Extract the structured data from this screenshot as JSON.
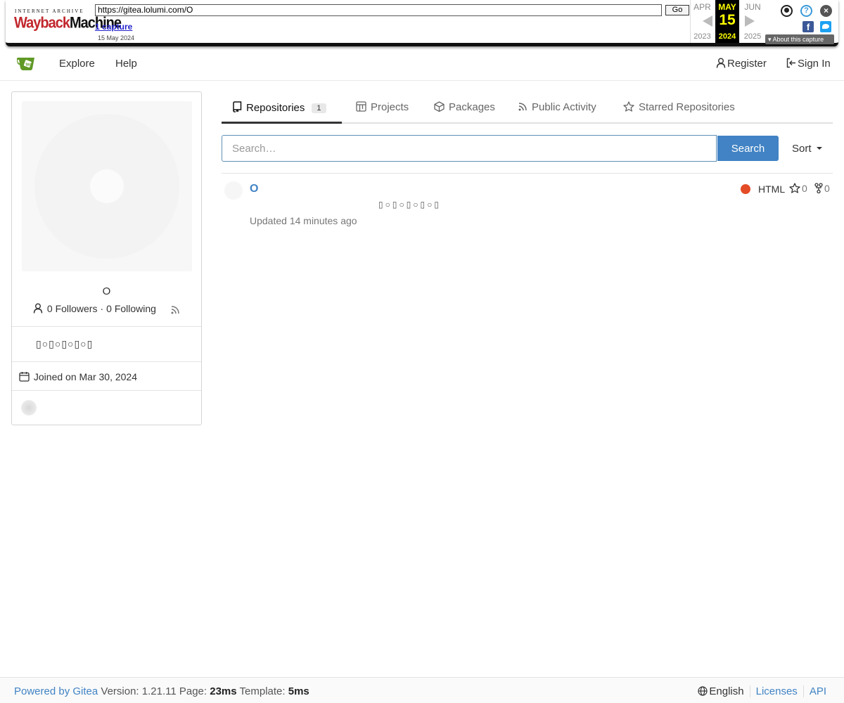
{
  "wayback": {
    "logo_top": "INTERNET ARCHIVE",
    "logo_main_a": "Wayback",
    "logo_main_b": "Machine",
    "url": "https://gitea.lolumi.com/O",
    "go_label": "Go",
    "captures": "1 capture",
    "capture_date": "15 May 2024",
    "prev_month": "APR",
    "prev_year": "2023",
    "cur_month": "MAY",
    "cur_day": "15",
    "cur_year": "2024",
    "next_month": "JUN",
    "next_year": "2025",
    "help_glyph": "?",
    "close_glyph": "×",
    "facebook_glyph": "f",
    "about": "About this capture"
  },
  "nav": {
    "explore": "Explore",
    "help": "Help",
    "register": "Register",
    "signin": "Sign In"
  },
  "profile": {
    "name": "O",
    "followers": "0 Followers",
    "separator": "·",
    "following": "0 Following",
    "bio": "▯○▯○▯○▯○▯",
    "joined": "Joined on Mar 30, 2024"
  },
  "tabs": {
    "repositories": "Repositories",
    "repo_count": "1",
    "projects": "Projects",
    "packages": "Packages",
    "activity": "Public Activity",
    "starred": "Starred Repositories"
  },
  "search": {
    "placeholder": "Search…",
    "button": "Search",
    "sort": "Sort"
  },
  "repos": [
    {
      "name": "O",
      "description": "▯○▯○▯○▯○▯",
      "updated": "Updated 14 minutes ago",
      "language": "HTML",
      "language_color": "#e34c26",
      "stars": "0",
      "forks": "0"
    }
  ],
  "footer": {
    "powered": "Powered by Gitea",
    "version": " Version: 1.21.11 Page: ",
    "page_time": "23ms",
    "template_label": " Template: ",
    "template_time": "5ms",
    "language": "English",
    "licenses": "Licenses",
    "api": "API"
  },
  "colors": {
    "accent": "#4183c4",
    "html_lang": "#e34c26",
    "wayback_red": "#c1272d"
  }
}
